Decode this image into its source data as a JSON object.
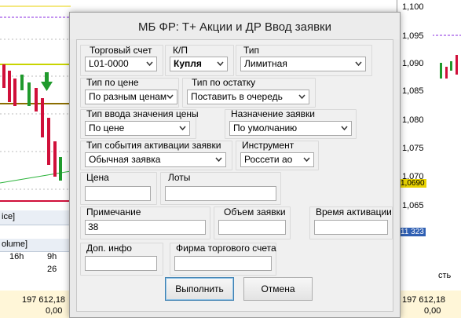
{
  "background": {
    "price_scale": [
      "1,100",
      "1,095",
      "1,090",
      "1,085",
      "1,080",
      "1,075",
      "1,070",
      "1,065"
    ],
    "price_tag_yellow": "1,0690",
    "price_tag_blue": "11 323",
    "left_panel_label": "ice]",
    "left_panel_label2": "olume]",
    "time_cells": [
      "16h",
      "9h"
    ],
    "time_value": "26",
    "right_strip_text": "сть",
    "bottom_left_values": [
      "197 612,18",
      "0,00"
    ],
    "bottom_right_values": [
      "197 612,18",
      "0,00"
    ],
    "colors": {
      "accent_yellow": "#e8d200",
      "accent_blue": "#2f5fb3",
      "candle_red": "#d0103a",
      "candle_green": "#1f9a2c"
    }
  },
  "dialog": {
    "title": "МБ ФР: Т+ Акции и ДР  Ввод заявки",
    "fields": {
      "account": {
        "label": "Торговый счет",
        "value": "L01-0000"
      },
      "side": {
        "label": "К/П",
        "value": "Купля"
      },
      "type": {
        "label": "Тип",
        "value": "Лимитная"
      },
      "price_type": {
        "label": "Тип по цене",
        "value": "По разным ценам"
      },
      "balance_type": {
        "label": "Тип по остатку",
        "value": "Поставить в очередь"
      },
      "price_input_type": {
        "label": "Тип ввода значения цены",
        "value": "По цене"
      },
      "purpose": {
        "label": "Назначение заявки",
        "value": "По умолчанию"
      },
      "activation_event": {
        "label": "Тип события активации заявки",
        "value": "Обычная заявка"
      },
      "instrument": {
        "label": "Инструмент",
        "value": "Россети ао"
      },
      "price": {
        "label": "Цена",
        "value": ""
      },
      "lots": {
        "label": "Лоты",
        "value": ""
      },
      "comment": {
        "label": "Примечание",
        "value": "38"
      },
      "order_volume": {
        "label": "Объем заявки",
        "value": ""
      },
      "activation_time": {
        "label": "Время активации",
        "value": ""
      },
      "extra_info": {
        "label": "Доп. инфо",
        "value": ""
      },
      "account_firm": {
        "label": "Фирма торгового счета",
        "value": ""
      }
    },
    "buttons": {
      "submit": "Выполнить",
      "cancel": "Отмена"
    }
  }
}
